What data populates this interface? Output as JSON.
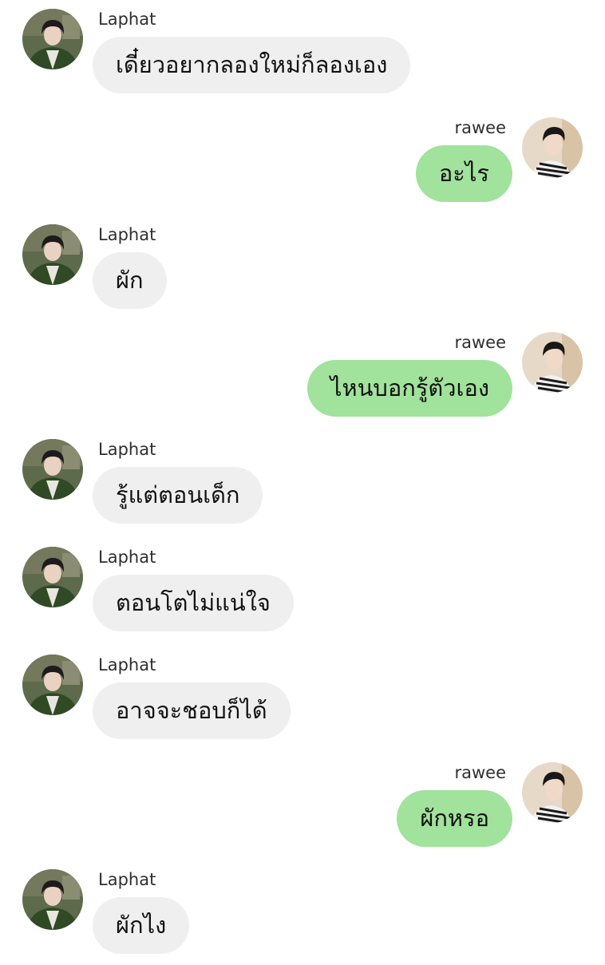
{
  "colors": {
    "incoming_bubble": "#efefef",
    "outgoing_bubble": "#a1e29c",
    "background": "#ffffff"
  },
  "icons": {
    "laphat_avatar": "laphat-avatar-photo",
    "rawee_avatar": "rawee-avatar-photo"
  },
  "messages": [
    {
      "sender": "Laphat",
      "text": "เดี๋ยวอยากลองใหม่ก็ลองเอง"
    },
    {
      "sender": "rawee",
      "text": "อะไร"
    },
    {
      "sender": "Laphat",
      "text": "ผัก"
    },
    {
      "sender": "rawee",
      "text": "ไหนบอกรู้ตัวเอง"
    },
    {
      "sender": "Laphat",
      "text": "รู้แต่ตอนเด็ก"
    },
    {
      "sender": "Laphat",
      "text": "ตอนโตไม่แน่ใจ"
    },
    {
      "sender": "Laphat",
      "text": "อาจจะชอบก็ได้"
    },
    {
      "sender": "rawee",
      "text": "ผักหรอ"
    },
    {
      "sender": "Laphat",
      "text": "ผักไง"
    }
  ]
}
